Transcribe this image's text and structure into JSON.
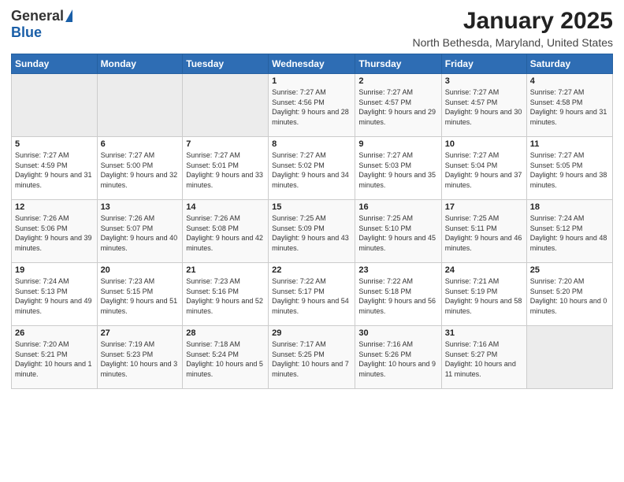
{
  "logo": {
    "general": "General",
    "blue": "Blue"
  },
  "title": "January 2025",
  "location": "North Bethesda, Maryland, United States",
  "weekdays": [
    "Sunday",
    "Monday",
    "Tuesday",
    "Wednesday",
    "Thursday",
    "Friday",
    "Saturday"
  ],
  "weeks": [
    [
      {
        "day": "",
        "info": ""
      },
      {
        "day": "",
        "info": ""
      },
      {
        "day": "",
        "info": ""
      },
      {
        "day": "1",
        "info": "Sunrise: 7:27 AM\nSunset: 4:56 PM\nDaylight: 9 hours and 28 minutes."
      },
      {
        "day": "2",
        "info": "Sunrise: 7:27 AM\nSunset: 4:57 PM\nDaylight: 9 hours and 29 minutes."
      },
      {
        "day": "3",
        "info": "Sunrise: 7:27 AM\nSunset: 4:57 PM\nDaylight: 9 hours and 30 minutes."
      },
      {
        "day": "4",
        "info": "Sunrise: 7:27 AM\nSunset: 4:58 PM\nDaylight: 9 hours and 31 minutes."
      }
    ],
    [
      {
        "day": "5",
        "info": "Sunrise: 7:27 AM\nSunset: 4:59 PM\nDaylight: 9 hours and 31 minutes."
      },
      {
        "day": "6",
        "info": "Sunrise: 7:27 AM\nSunset: 5:00 PM\nDaylight: 9 hours and 32 minutes."
      },
      {
        "day": "7",
        "info": "Sunrise: 7:27 AM\nSunset: 5:01 PM\nDaylight: 9 hours and 33 minutes."
      },
      {
        "day": "8",
        "info": "Sunrise: 7:27 AM\nSunset: 5:02 PM\nDaylight: 9 hours and 34 minutes."
      },
      {
        "day": "9",
        "info": "Sunrise: 7:27 AM\nSunset: 5:03 PM\nDaylight: 9 hours and 35 minutes."
      },
      {
        "day": "10",
        "info": "Sunrise: 7:27 AM\nSunset: 5:04 PM\nDaylight: 9 hours and 37 minutes."
      },
      {
        "day": "11",
        "info": "Sunrise: 7:27 AM\nSunset: 5:05 PM\nDaylight: 9 hours and 38 minutes."
      }
    ],
    [
      {
        "day": "12",
        "info": "Sunrise: 7:26 AM\nSunset: 5:06 PM\nDaylight: 9 hours and 39 minutes."
      },
      {
        "day": "13",
        "info": "Sunrise: 7:26 AM\nSunset: 5:07 PM\nDaylight: 9 hours and 40 minutes."
      },
      {
        "day": "14",
        "info": "Sunrise: 7:26 AM\nSunset: 5:08 PM\nDaylight: 9 hours and 42 minutes."
      },
      {
        "day": "15",
        "info": "Sunrise: 7:25 AM\nSunset: 5:09 PM\nDaylight: 9 hours and 43 minutes."
      },
      {
        "day": "16",
        "info": "Sunrise: 7:25 AM\nSunset: 5:10 PM\nDaylight: 9 hours and 45 minutes."
      },
      {
        "day": "17",
        "info": "Sunrise: 7:25 AM\nSunset: 5:11 PM\nDaylight: 9 hours and 46 minutes."
      },
      {
        "day": "18",
        "info": "Sunrise: 7:24 AM\nSunset: 5:12 PM\nDaylight: 9 hours and 48 minutes."
      }
    ],
    [
      {
        "day": "19",
        "info": "Sunrise: 7:24 AM\nSunset: 5:13 PM\nDaylight: 9 hours and 49 minutes."
      },
      {
        "day": "20",
        "info": "Sunrise: 7:23 AM\nSunset: 5:15 PM\nDaylight: 9 hours and 51 minutes."
      },
      {
        "day": "21",
        "info": "Sunrise: 7:23 AM\nSunset: 5:16 PM\nDaylight: 9 hours and 52 minutes."
      },
      {
        "day": "22",
        "info": "Sunrise: 7:22 AM\nSunset: 5:17 PM\nDaylight: 9 hours and 54 minutes."
      },
      {
        "day": "23",
        "info": "Sunrise: 7:22 AM\nSunset: 5:18 PM\nDaylight: 9 hours and 56 minutes."
      },
      {
        "day": "24",
        "info": "Sunrise: 7:21 AM\nSunset: 5:19 PM\nDaylight: 9 hours and 58 minutes."
      },
      {
        "day": "25",
        "info": "Sunrise: 7:20 AM\nSunset: 5:20 PM\nDaylight: 10 hours and 0 minutes."
      }
    ],
    [
      {
        "day": "26",
        "info": "Sunrise: 7:20 AM\nSunset: 5:21 PM\nDaylight: 10 hours and 1 minute."
      },
      {
        "day": "27",
        "info": "Sunrise: 7:19 AM\nSunset: 5:23 PM\nDaylight: 10 hours and 3 minutes."
      },
      {
        "day": "28",
        "info": "Sunrise: 7:18 AM\nSunset: 5:24 PM\nDaylight: 10 hours and 5 minutes."
      },
      {
        "day": "29",
        "info": "Sunrise: 7:17 AM\nSunset: 5:25 PM\nDaylight: 10 hours and 7 minutes."
      },
      {
        "day": "30",
        "info": "Sunrise: 7:16 AM\nSunset: 5:26 PM\nDaylight: 10 hours and 9 minutes."
      },
      {
        "day": "31",
        "info": "Sunrise: 7:16 AM\nSunset: 5:27 PM\nDaylight: 10 hours and 11 minutes."
      },
      {
        "day": "",
        "info": ""
      }
    ]
  ]
}
